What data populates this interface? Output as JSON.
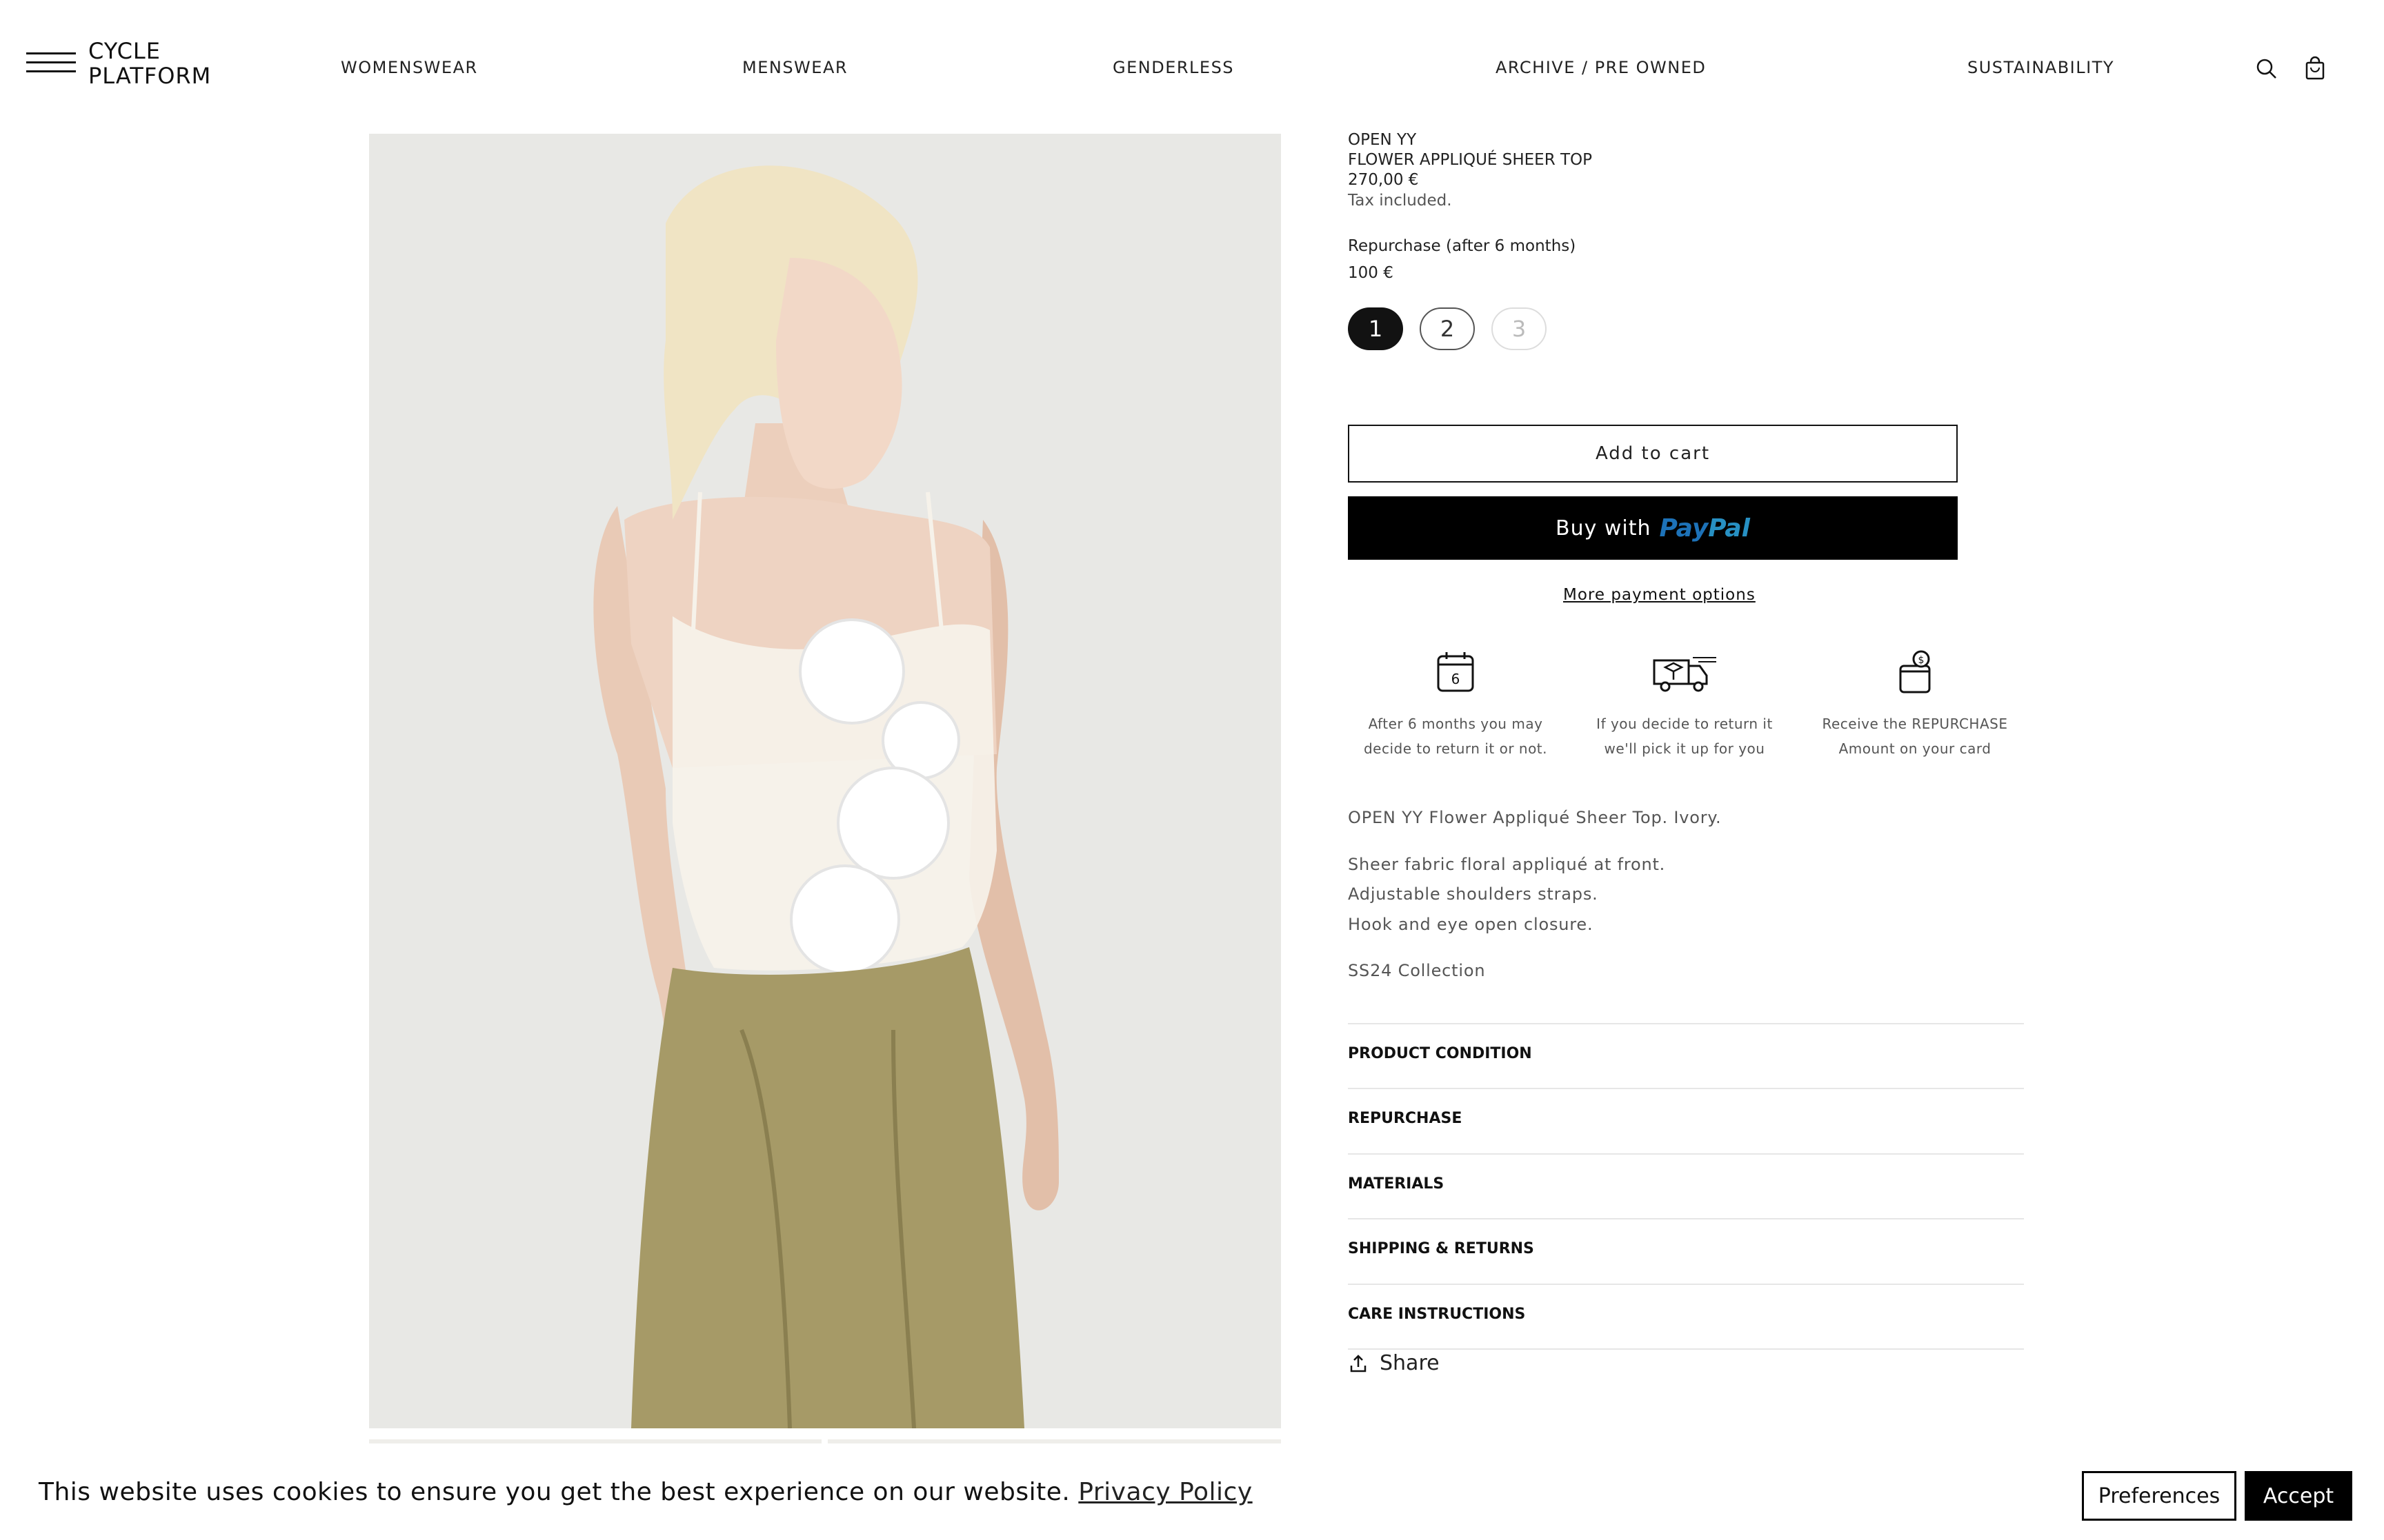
{
  "header": {
    "logo_line1": "CYCLE",
    "logo_line2": "PLATFORM",
    "nav": [
      "WOMENSWEAR",
      "MENSWEAR",
      "GENDERLESS",
      "ARCHIVE / PRE OWNED",
      "SUSTAINABILITY"
    ]
  },
  "product": {
    "brand": "OPEN YY",
    "name": "FLOWER APPLIQUÉ SHEER TOP",
    "price": "270,00 €",
    "tax_note": "Tax included.",
    "repurchase_label": "Repurchase (after 6 months)",
    "repurchase_price": "100 €",
    "quantity_options": [
      "1",
      "2",
      "3"
    ],
    "selected_quantity": "1",
    "add_to_cart": "Add to cart",
    "paypal_buy": "Buy with",
    "paypal_brand_a": "Pay",
    "paypal_brand_b": "Pal",
    "more_payment": "More payment options",
    "calendar_icon_number": "6"
  },
  "features": [
    {
      "icon": "calendar-icon",
      "line1": "After 6 months you may",
      "line2": "decide to return it or not."
    },
    {
      "icon": "delivery-truck-icon",
      "line1": "If you decide to return it",
      "line2": "we'll pick it up for you"
    },
    {
      "icon": "wallet-money-icon",
      "line1": "Receive the REPURCHASE",
      "line2": "Amount on your card"
    }
  ],
  "description": {
    "title": "OPEN YY Flower Appliqué Sheer Top. Ivory.",
    "details": [
      "Sheer fabric floral appliqué at front.",
      "Adjustable shoulders straps.",
      "Hook and eye open closure."
    ],
    "collection": "SS24 Collection"
  },
  "accordion": [
    "PRODUCT CONDITION",
    "REPURCHASE",
    "MATERIALS",
    "SHIPPING & RETURNS",
    "CARE INSTRUCTIONS"
  ],
  "share_label": "Share",
  "cookie": {
    "text": "This website uses cookies to ensure you get the best experience on our website.",
    "link": "Privacy Policy",
    "preferences": "Preferences",
    "accept": "Accept"
  },
  "colors": {
    "accent": "#000000",
    "paypal_light": "#2790c3",
    "paypal_dark": "#1d72b8",
    "image_bg": "#e8e8e5"
  }
}
